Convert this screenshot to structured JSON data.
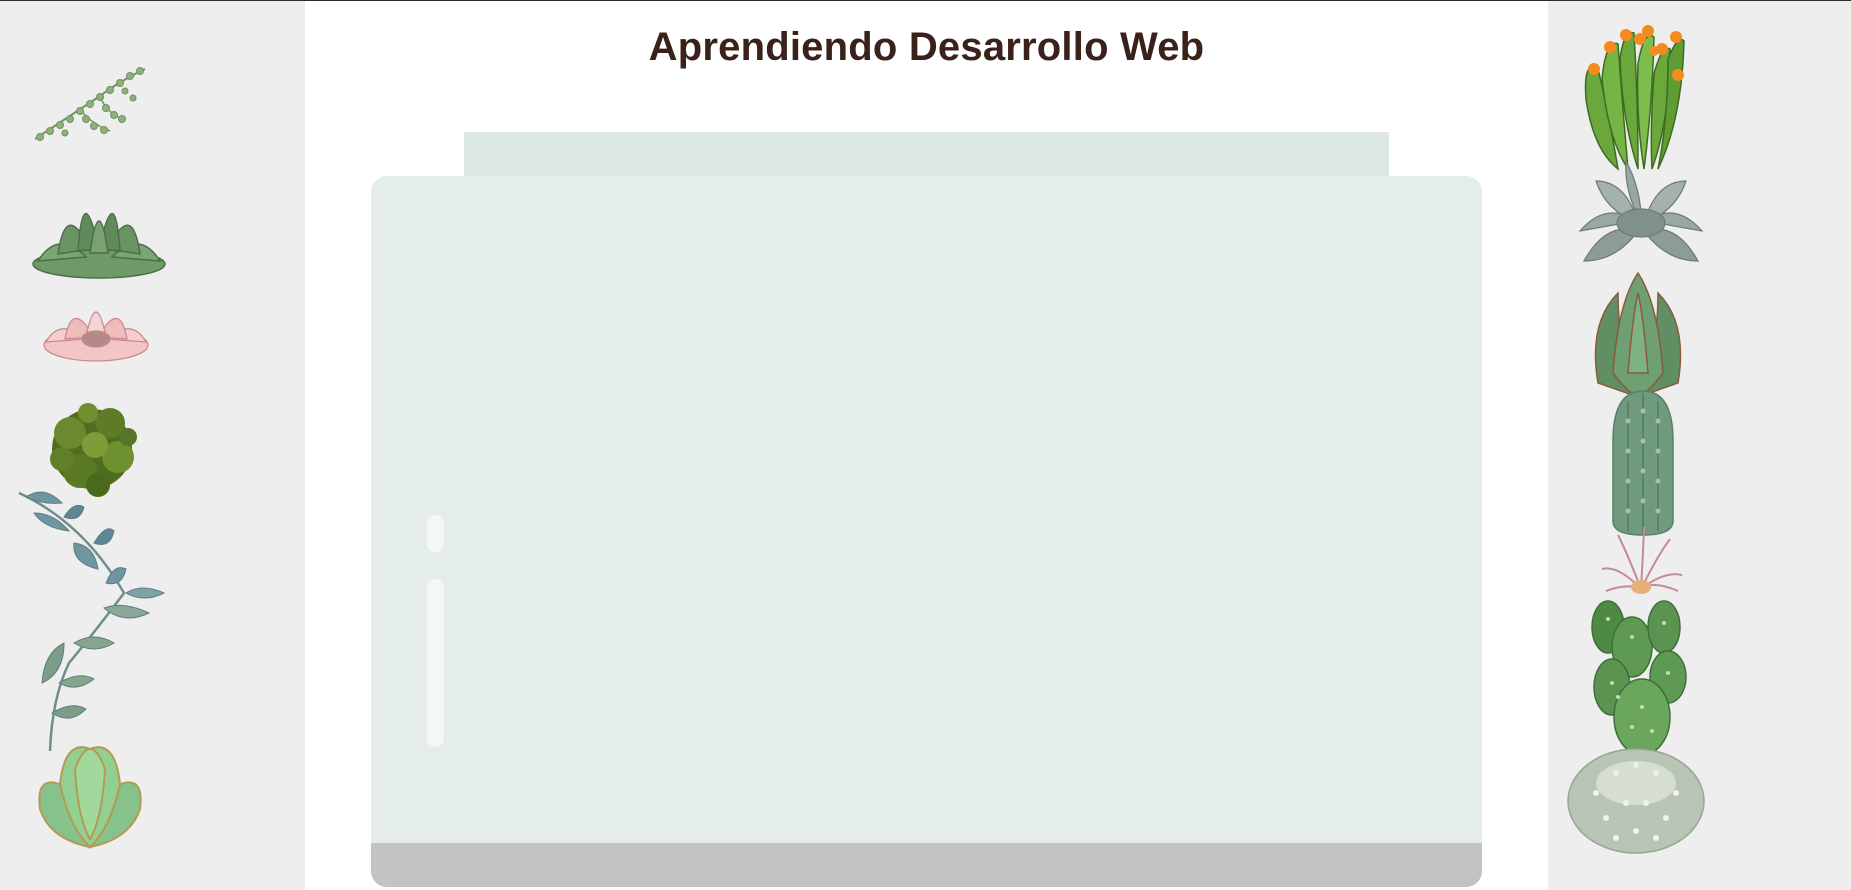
{
  "page": {
    "title": "Aprendiendo Desarrollo Web"
  },
  "colors": {
    "background": "#ffffff",
    "side_panel": "#eeeeee",
    "title": "#3a2119",
    "jar_lid": "#dde8e6",
    "jar_body": "#e5edec",
    "jar_bottom": "#c2c3c2",
    "edge_accent": "#c2185b"
  },
  "decorations": {
    "left_plants": [
      "string-of-pearls",
      "green-succulent",
      "pink-succulent",
      "moss-cluster",
      "eucalyptus-branch",
      "light-green-succulent"
    ],
    "right_plants": [
      "flowering-cactus",
      "grey-echeveria",
      "aloe",
      "columnar-cactus",
      "air-plant",
      "paddle-cactus",
      "round-cactus"
    ]
  }
}
